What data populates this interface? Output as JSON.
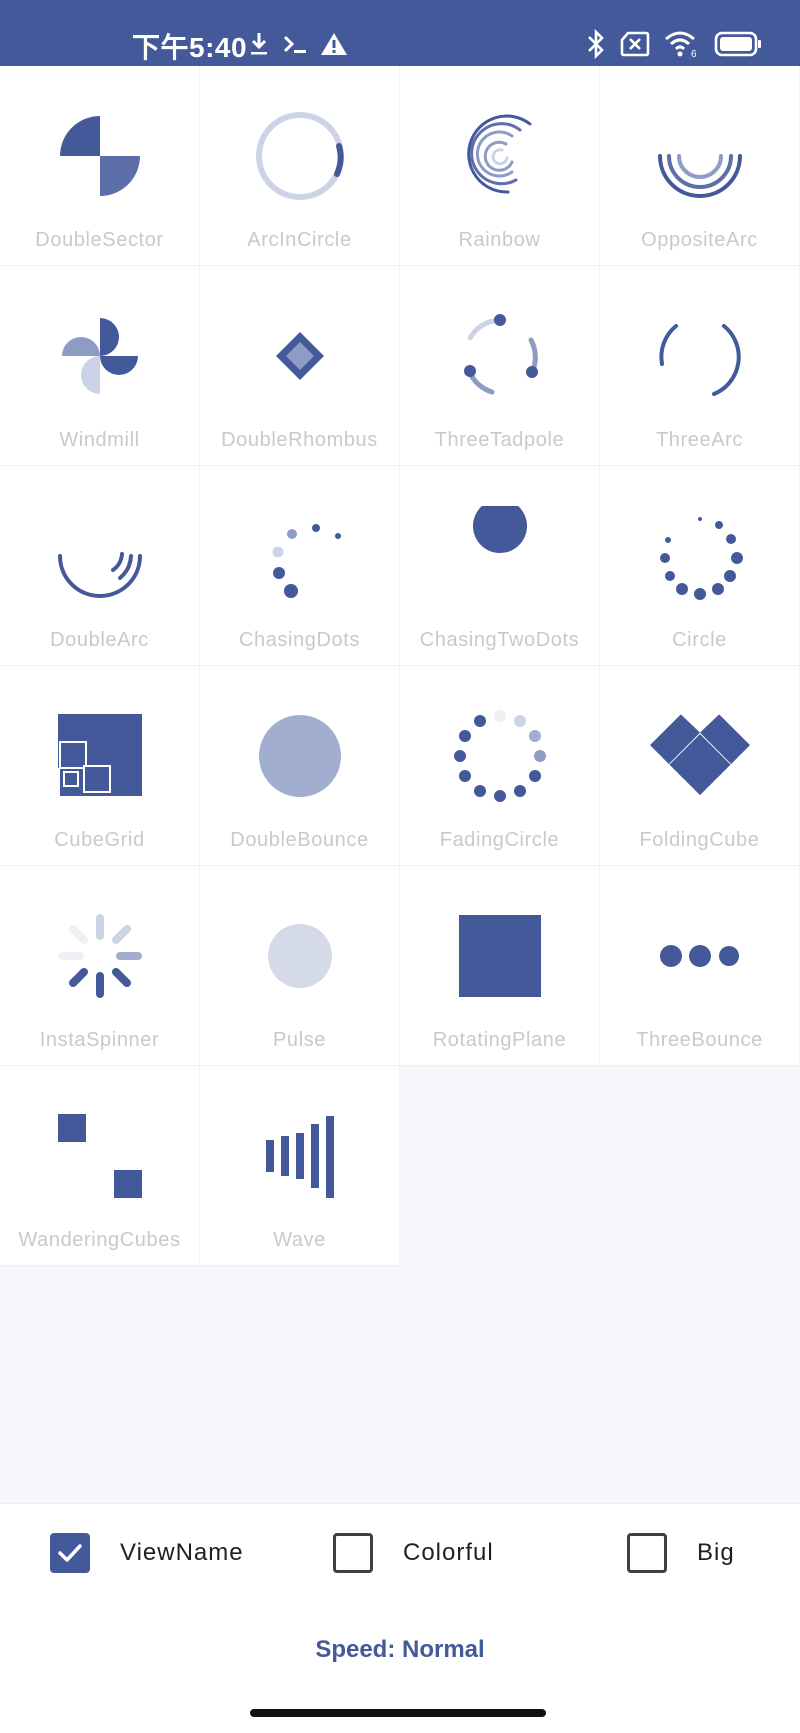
{
  "status_bar": {
    "time": "下午5:40",
    "left_icons": [
      "download-icon",
      "terminal-icon",
      "warning-icon"
    ],
    "right_icons": [
      "bluetooth-icon",
      "sim-off-icon",
      "wifi-icon",
      "battery-icon"
    ],
    "wifi_badge": "6"
  },
  "spinners": [
    {
      "name": "DoubleSector"
    },
    {
      "name": "ArcInCircle"
    },
    {
      "name": "Rainbow"
    },
    {
      "name": "OppositeArc"
    },
    {
      "name": "Windmill"
    },
    {
      "name": "DoubleRhombus"
    },
    {
      "name": "ThreeTadpole"
    },
    {
      "name": "ThreeArc"
    },
    {
      "name": "DoubleArc"
    },
    {
      "name": "ChasingDots"
    },
    {
      "name": "ChasingTwoDots"
    },
    {
      "name": "Circle"
    },
    {
      "name": "CubeGrid"
    },
    {
      "name": "DoubleBounce"
    },
    {
      "name": "FadingCircle"
    },
    {
      "name": "FoldingCube"
    },
    {
      "name": "InstaSpinner"
    },
    {
      "name": "Pulse"
    },
    {
      "name": "RotatingPlane"
    },
    {
      "name": "ThreeBounce"
    },
    {
      "name": "WanderingCubes"
    },
    {
      "name": "Wave"
    }
  ],
  "options": {
    "view_name": {
      "label": "ViewName",
      "checked": true
    },
    "colorful": {
      "label": "Colorful",
      "checked": false
    },
    "big": {
      "label": "Big",
      "checked": false
    }
  },
  "speed_label": "Speed: Normal",
  "colors": {
    "accent": "#44599a",
    "light": "#8e9cc4",
    "pale": "#cdd3e6",
    "label": "#c7c9d0"
  }
}
